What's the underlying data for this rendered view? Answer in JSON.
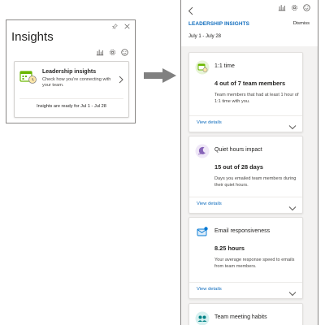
{
  "insights_pane": {
    "title": "Insights",
    "summary_card": {
      "title": "Leadership insights",
      "subtitle": "Check how you're connecting with your team.",
      "footer": "Insights are ready for Jul 1 - Jul 28"
    }
  },
  "detail_panel": {
    "heading": "LEADERSHIP INSIGHTS",
    "dismiss_label": "Dismiss",
    "date_range": "July 1 - July 28",
    "cards": [
      {
        "icon": "one-on-one-icon",
        "title": "1:1 time",
        "value": "4 out of 7 team members",
        "description": "Team members that had at least 1 hour of 1:1 time with you.",
        "link": "View details"
      },
      {
        "icon": "quiet-hours-icon",
        "title": "Quiet hours impact",
        "value": "15 out of 28 days",
        "description": "Days you emailed team members during their quiet hours.",
        "link": "View details"
      },
      {
        "icon": "email-responsiveness-icon",
        "title": "Email responsiveness",
        "value": "8.25 hours",
        "description": "Your average response speed to emails from team members.",
        "link": "View details"
      },
      {
        "icon": "team-meeting-icon",
        "title": "Team meeting habits"
      }
    ]
  },
  "colors": {
    "accent_blue": "#0f6cbd",
    "icon_green": "#6bb700",
    "icon_purple": "#8764b8",
    "icon_blue": "#0078d4",
    "icon_teal": "#038387"
  }
}
